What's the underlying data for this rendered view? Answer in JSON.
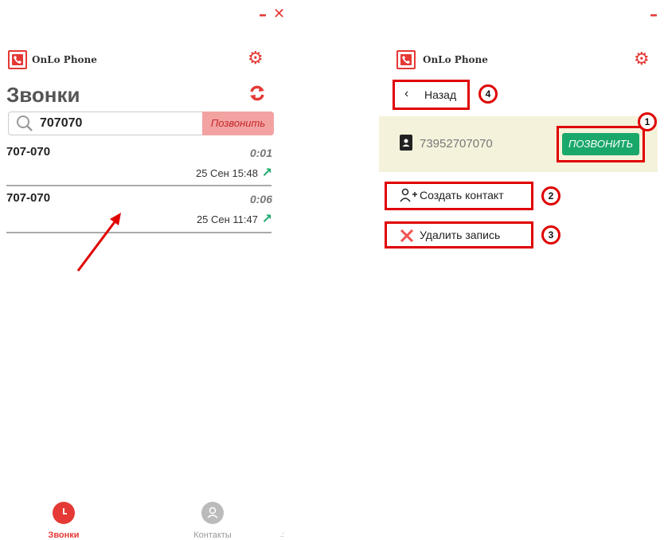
{
  "left_window": {
    "controls": {
      "minimize": "–",
      "close": "✕"
    },
    "app_name": "OnLo Phone",
    "title": "Звонки",
    "search": {
      "value": "707070",
      "call_button": "Позвонить"
    },
    "calls": [
      {
        "number": "707-070",
        "duration": "0:01",
        "datetime": "25 Сен 15:48",
        "direction_icon": "outgoing-arrow-icon"
      },
      {
        "number": "707-070",
        "duration": "0:06",
        "datetime": "25 Сен 11:47",
        "direction_icon": "outgoing-arrow-icon"
      }
    ],
    "bottom_nav": [
      {
        "label": "Звонки",
        "active": true
      },
      {
        "label": "Контакты",
        "active": false
      }
    ],
    "grip": ".:"
  },
  "right_window": {
    "controls": {
      "minimize": "–",
      "close": "✕"
    },
    "app_name": "OnLo Phone",
    "back_label": "Назад",
    "contact_number": "73952707070",
    "call_button": "ПОЗВОНИТЬ",
    "create_contact_label": "Создать контакт",
    "delete_record_label": "Удалить запись"
  },
  "annotations": {
    "n1": "1",
    "n2": "2",
    "n3": "3",
    "n4": "4"
  },
  "colors": {
    "accent": "#e53935",
    "annotation": "#e00000",
    "green": "#1aa86a",
    "card_bg": "#f5f2dc",
    "search_button_bg": "#f3a2a2"
  }
}
